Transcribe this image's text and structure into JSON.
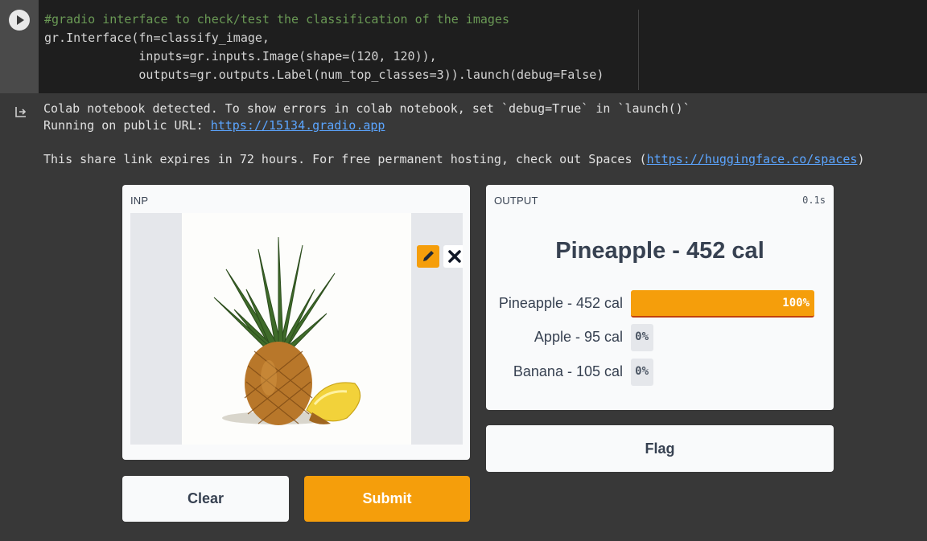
{
  "code_cell": {
    "lines": [
      "#gradio interface to check/test the classification of the images",
      "gr.Interface(fn=classify_image,",
      "             inputs=gr.inputs.Image(shape=(120, 120)),",
      "             outputs=gr.outputs.Label(num_top_classes=3)).launch(debug=False)"
    ]
  },
  "stdout": {
    "line1": "Colab notebook detected. To show errors in colab notebook, set `debug=True` in `launch()`",
    "line2_prefix": "Running on public URL: ",
    "line2_link": "https://15134.gradio.app",
    "line4_prefix": "This share link expires in 72 hours. For free permanent hosting, check out Spaces (",
    "line4_link": "https://huggingface.co/spaces",
    "line4_suffix": ")"
  },
  "input_panel": {
    "label": "INP",
    "image_subject": "pineapple"
  },
  "output_panel": {
    "label": "OUTPUT",
    "timing": "0.1s",
    "top_label": "Pineapple - 452 cal",
    "confidences": [
      {
        "name": "Pineapple - 452 cal",
        "value_text": "100%",
        "value": 1.0
      },
      {
        "name": "Apple - 95 cal",
        "value_text": "0%",
        "value": 0.0
      },
      {
        "name": "Banana - 105 cal",
        "value_text": "0%",
        "value": 0.0
      }
    ]
  },
  "buttons": {
    "flag": "Flag",
    "clear": "Clear",
    "submit": "Submit"
  },
  "colors": {
    "accent": "#f59e0b",
    "panel_bg": "#f9fafb",
    "page_bg": "#383838",
    "link": "#5ba5ff"
  },
  "icons": [
    "play-icon",
    "output-redirect-icon",
    "pencil-icon",
    "close-icon"
  ]
}
